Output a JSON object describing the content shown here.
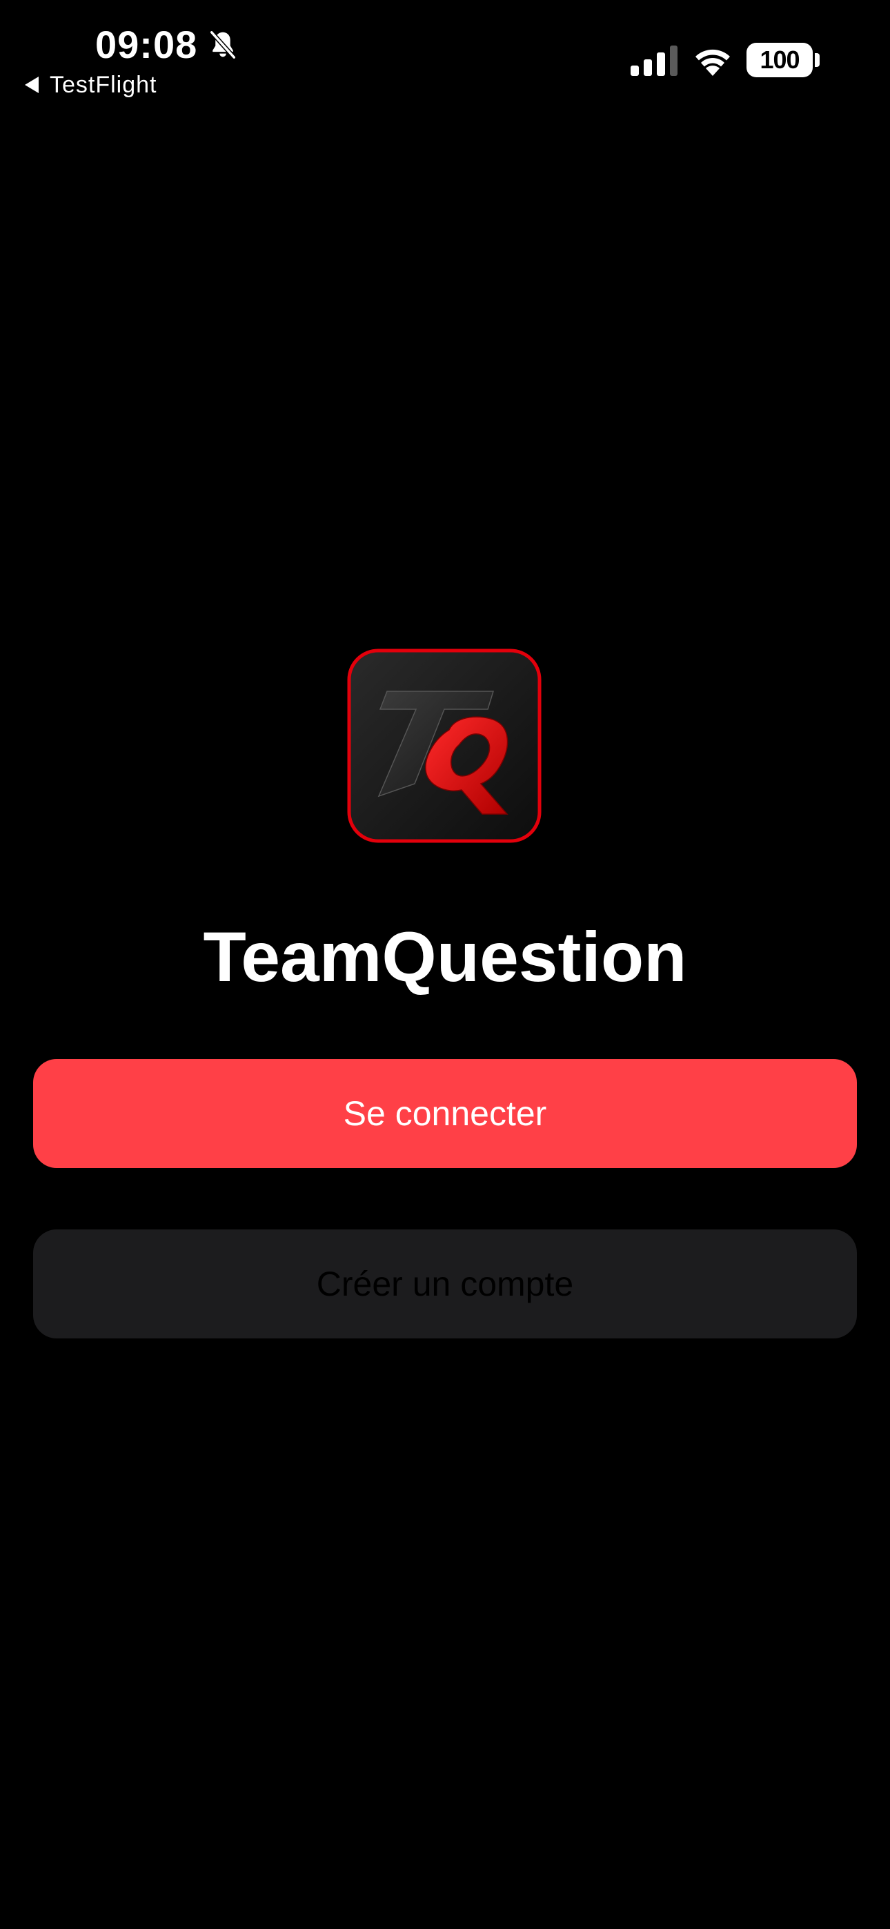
{
  "status_bar": {
    "time": "09:08",
    "back_label": "TestFlight",
    "battery_level": "100",
    "icons": [
      "bell-slash-icon",
      "cellular-signal-icon",
      "wifi-icon",
      "battery-icon"
    ]
  },
  "app": {
    "title": "TeamQuestion",
    "logo_letters": "TQ"
  },
  "actions": {
    "login_label": "Se connecter",
    "signup_label": "Créer un compte"
  },
  "colors": {
    "background": "#000000",
    "accent": "#ff4047",
    "secondary_button": "#1c1c1e",
    "logo_red": "#e3000b"
  }
}
